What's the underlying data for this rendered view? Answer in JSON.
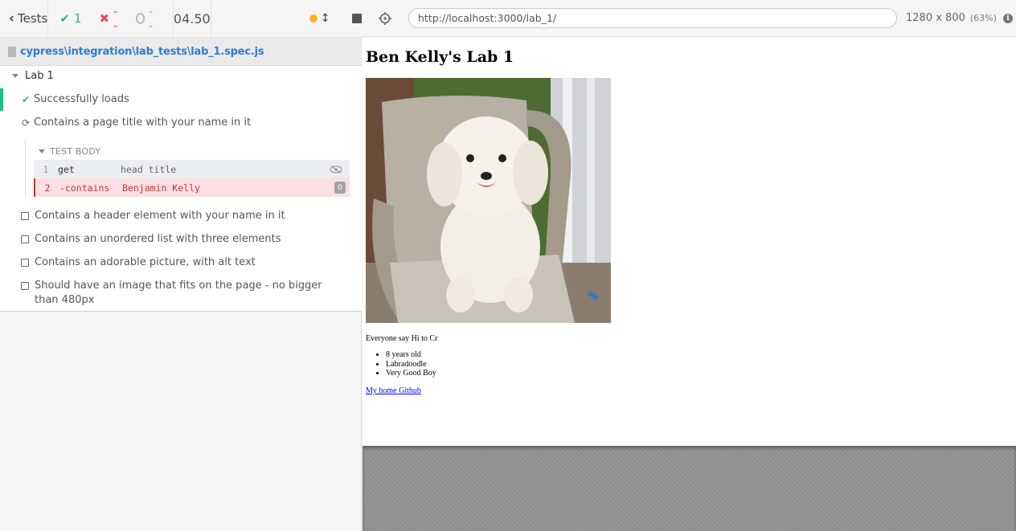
{
  "reporter": {
    "tests_button_label": "Tests",
    "stats": {
      "passed": "1",
      "failed": "--",
      "pending": "--"
    },
    "duration": "04.50",
    "spec_path": "cypress\\integration\\lab_tests\\lab_1.spec.js",
    "suite_title": "Lab 1",
    "tests": [
      {
        "title": "Successfully loads",
        "state": "passed"
      },
      {
        "title": "Contains a page title with your name in it",
        "state": "running"
      },
      {
        "title": "Contains a header element with your name in it",
        "state": "pending"
      },
      {
        "title": "Contains an unordered list with three elements",
        "state": "pending"
      },
      {
        "title": "Contains an adorable picture, with alt text",
        "state": "pending"
      },
      {
        "title": "Should have an image that fits on the page - no bigger than 480px",
        "state": "pending"
      }
    ],
    "test_body_label": "TEST BODY",
    "commands": [
      {
        "num": "1",
        "name": "get",
        "message": "head title"
      },
      {
        "num": "2",
        "name": "-contains",
        "message": "Benjamin Kelly",
        "badge": "0"
      }
    ],
    "colors": {
      "pass": "#3aaf85",
      "fail": "#e94f5f",
      "running": "#f5b61e",
      "link": "#2f7bd8"
    }
  },
  "aut": {
    "url": "http://localhost:3000/lab_1/",
    "viewport": "1280 x 800",
    "scale": "(63%)",
    "page": {
      "heading": "Ben Kelly's Lab 1",
      "paragraph": "Everyone say Hi to Cr",
      "list_items": [
        "8 years old",
        "Labradoodle",
        "Very Good Boy"
      ],
      "link_text": "My home Github"
    }
  }
}
